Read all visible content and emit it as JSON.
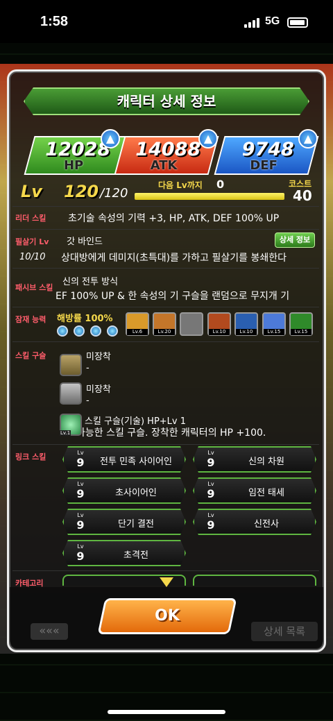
{
  "status": {
    "time": "1:58",
    "network": "5G"
  },
  "header": {
    "title": "캐릭터 상세 정보"
  },
  "stats": {
    "hp_value": "12028",
    "hp_label": "HP",
    "atk_value": "14088",
    "atk_label": "ATK",
    "def_value": "9748",
    "def_label": "DEF"
  },
  "level": {
    "lv_label": "Lv",
    "current": "120",
    "max": "/120",
    "next_label": "다음 Lv까지",
    "next_value": "0",
    "cost_label": "코스트",
    "cost_value": "40"
  },
  "leader": {
    "label": "리더 스킬",
    "text": "초기술 속성의 기력 +3, HP, ATK, DEF 100% UP"
  },
  "super_attack": {
    "label": "필살기 Lv",
    "level": "10/10",
    "name": "갓 바인드",
    "detail_button": "상세 정보",
    "text": "상대방에게 데미지(초특대)를 가하고 필살기를 봉쇄한다"
  },
  "passive": {
    "label": "패시브 스킬",
    "name": "신의 전투 방식",
    "text": "EF 100% UP & 한 속성의 기 구슬을 랜덤으로 무지개 기"
  },
  "hidden_potential": {
    "label": "잠재 능력",
    "release_text": "해방률 100%",
    "badges": [
      {
        "level": "Lv.6"
      },
      {
        "level": "Lv.20"
      },
      {
        "level": ""
      },
      {
        "level": "Lv.10"
      },
      {
        "level": "Lv.10"
      },
      {
        "level": "Lv.15"
      },
      {
        "level": "Lv.15"
      }
    ]
  },
  "skill_orbs": {
    "label": "스킬 구슬",
    "slots": [
      {
        "name": "미장착",
        "detail": "-"
      },
      {
        "name": "미장착",
        "detail": "-"
      },
      {
        "name": "스킬 구슬(기술) HP+Lv 1",
        "detail": "가능한 스킬 구슬. 장착한 캐릭터의 HP +100.",
        "badge": "Lv.1"
      }
    ]
  },
  "link_skills": {
    "label": "링크 스킬",
    "lv_small": "Lv",
    "items": [
      {
        "level": "9",
        "name": "전투 민족 사이어인"
      },
      {
        "level": "9",
        "name": "신의 차원"
      },
      {
        "level": "9",
        "name": "초사이어인"
      },
      {
        "level": "9",
        "name": "임전 태세"
      },
      {
        "level": "9",
        "name": "단기 결전"
      },
      {
        "level": "9",
        "name": "신전사"
      },
      {
        "level": "9",
        "name": "초격전"
      }
    ]
  },
  "category": {
    "label": "카테고리"
  },
  "footer": {
    "ok_label": "OK",
    "list_label": "상세 목록"
  }
}
